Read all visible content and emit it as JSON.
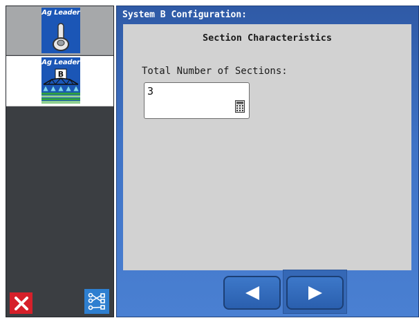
{
  "sidebar": {
    "items": [
      {
        "logo_text": "Ag Leader",
        "icon": "toggle-switch-icon"
      },
      {
        "logo_text": "Ag Leader",
        "icon": "boom-sprayer-icon",
        "badge": "B"
      }
    ],
    "footer": {
      "close_icon": "close-icon",
      "route_icon": "route-network-icon"
    }
  },
  "main": {
    "title": "System B Configuration:",
    "section_heading": "Section Characteristics",
    "field_label": "Total Number of Sections:",
    "field_value": "3",
    "field_icon": "calculator-icon"
  },
  "nav": {
    "back_icon": "arrow-left-icon",
    "next_icon": "arrow-right-icon"
  },
  "colors": {
    "header_blue": "#2f5aa6",
    "panel_gray": "#d2d2d2",
    "close_red": "#d6202a",
    "nav_blue": "#2a5fae"
  }
}
